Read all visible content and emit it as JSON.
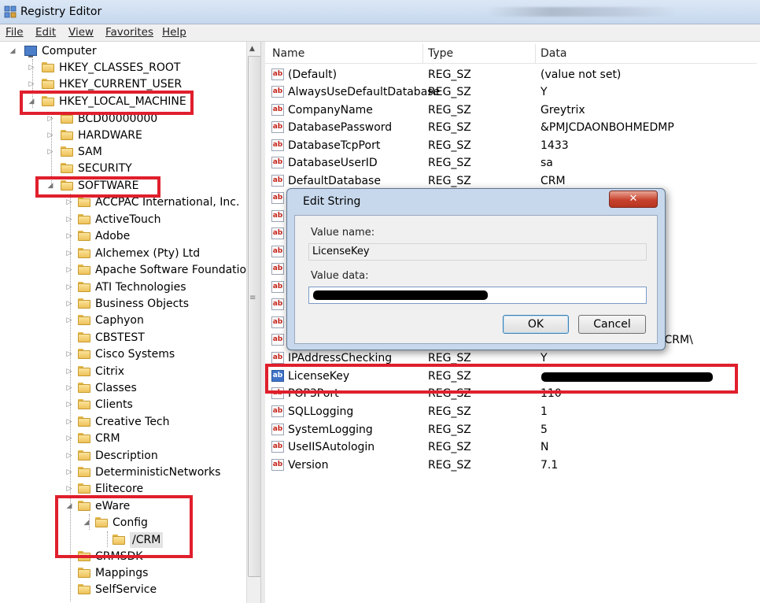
{
  "window": {
    "title": "Registry Editor"
  },
  "menu": [
    "File",
    "Edit",
    "View",
    "Favorites",
    "Help"
  ],
  "tree": {
    "root": "Computer",
    "hives": [
      "HKEY_CLASSES_ROOT",
      "HKEY_CURRENT_USER",
      "HKEY_LOCAL_MACHINE"
    ],
    "hklm_children": [
      "BCD00000000",
      "HARDWARE",
      "SAM",
      "SECURITY",
      "SOFTWARE"
    ],
    "software_children": [
      "ACCPAC International, Inc.",
      "ActiveTouch",
      "Adobe",
      "Alchemex (Pty) Ltd",
      "Apache Software Foundation",
      "ATI Technologies",
      "Business Objects",
      "Caphyon",
      "CBSTEST",
      "Cisco Systems",
      "Citrix",
      "Classes",
      "Clients",
      "Creative Tech",
      "CRM",
      "Description",
      "DeterministicNetworks",
      "Elitecore",
      "eWare"
    ],
    "eware_child": "Config",
    "config_child": "/CRM",
    "after_eware": [
      "CRMSDK",
      "Mappings",
      "SelfService"
    ]
  },
  "columns": {
    "name": "Name",
    "type": "Type",
    "data": "Data"
  },
  "values": [
    {
      "name": "(Default)",
      "type": "REG_SZ",
      "data": "(value not set)"
    },
    {
      "name": "AlwaysUseDefaultDatabase",
      "type": "REG_SZ",
      "data": "Y"
    },
    {
      "name": "CompanyName",
      "type": "REG_SZ",
      "data": "Greytrix"
    },
    {
      "name": "DatabasePassword",
      "type": "REG_SZ",
      "data": "&PMJCDAONBOHMEDMP"
    },
    {
      "name": "DatabaseTcpPort",
      "type": "REG_SZ",
      "data": "1433"
    },
    {
      "name": "DatabaseUserID",
      "type": "REG_SZ",
      "data": "sa"
    },
    {
      "name": "DefaultDatabase",
      "type": "REG_SZ",
      "data": "CRM"
    },
    {
      "name": "D",
      "type": "",
      "data": ""
    },
    {
      "name": "D",
      "type": "",
      "data": ""
    },
    {
      "name": "D",
      "type": "",
      "data": ""
    },
    {
      "name": "E",
      "type": "",
      "data": ""
    },
    {
      "name": "E",
      "type": "",
      "data": ""
    },
    {
      "name": "E",
      "type": "",
      "data": ""
    },
    {
      "name": "E",
      "type": "",
      "data": ""
    },
    {
      "name": "H",
      "type": "",
      "data": ""
    },
    {
      "name": "In",
      "type": "",
      "data": "RM\\CRM\\"
    },
    {
      "name": "IPAddressChecking",
      "type": "REG_SZ",
      "data": "Y"
    },
    {
      "name": "LicenseKey",
      "type": "REG_SZ",
      "data": ""
    },
    {
      "name": "POP3Port",
      "type": "REG_SZ",
      "data": "110"
    },
    {
      "name": "SQLLogging",
      "type": "REG_SZ",
      "data": "1"
    },
    {
      "name": "SystemLogging",
      "type": "REG_SZ",
      "data": "5"
    },
    {
      "name": "UseIISAutologin",
      "type": "REG_SZ",
      "data": "N"
    },
    {
      "name": "Version",
      "type": "REG_SZ",
      "data": "7.1"
    }
  ],
  "dialog": {
    "title": "Edit String",
    "close_glyph": "✕",
    "value_name_label": "Value name:",
    "value_name": "LicenseKey",
    "value_data_label": "Value data:",
    "ok": "OK",
    "cancel": "Cancel"
  },
  "icons": {
    "string_value": "ab"
  },
  "colors": {
    "highlight_box": "#e01f2c",
    "dialog_frame": "#c8d8ec"
  }
}
